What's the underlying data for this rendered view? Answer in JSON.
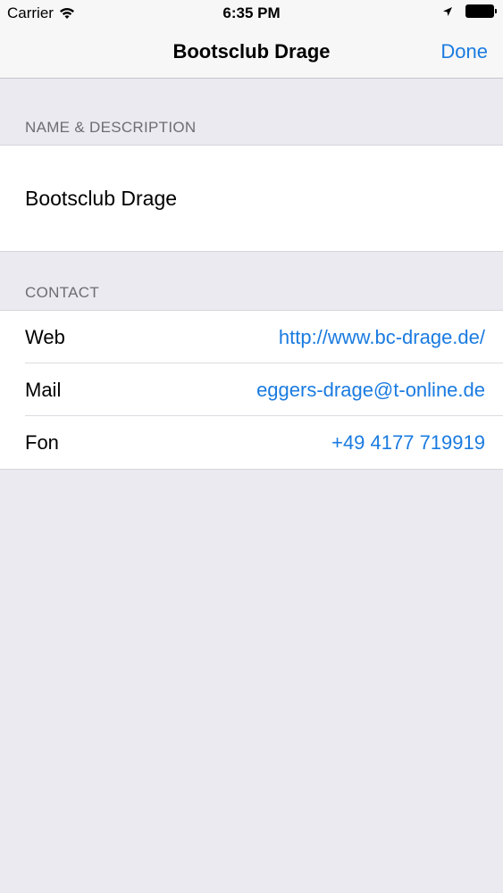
{
  "status": {
    "carrier": "Carrier",
    "time": "6:35 PM"
  },
  "nav": {
    "title": "Bootsclub Drage",
    "done_label": "Done"
  },
  "sections": {
    "name_header": "NAME & DESCRIPTION",
    "name_value": "Bootsclub Drage",
    "contact_header": "CONTACT"
  },
  "contact": [
    {
      "label": "Web",
      "value": "http://www.bc-drage.de/"
    },
    {
      "label": "Mail",
      "value": "eggers-drage@t-online.de"
    },
    {
      "label": "Fon",
      "value": "+49 4177 719919"
    }
  ],
  "colors": {
    "accent": "#1A7BE0",
    "background": "#EBEAF1",
    "header_text": "#6D6D72"
  }
}
